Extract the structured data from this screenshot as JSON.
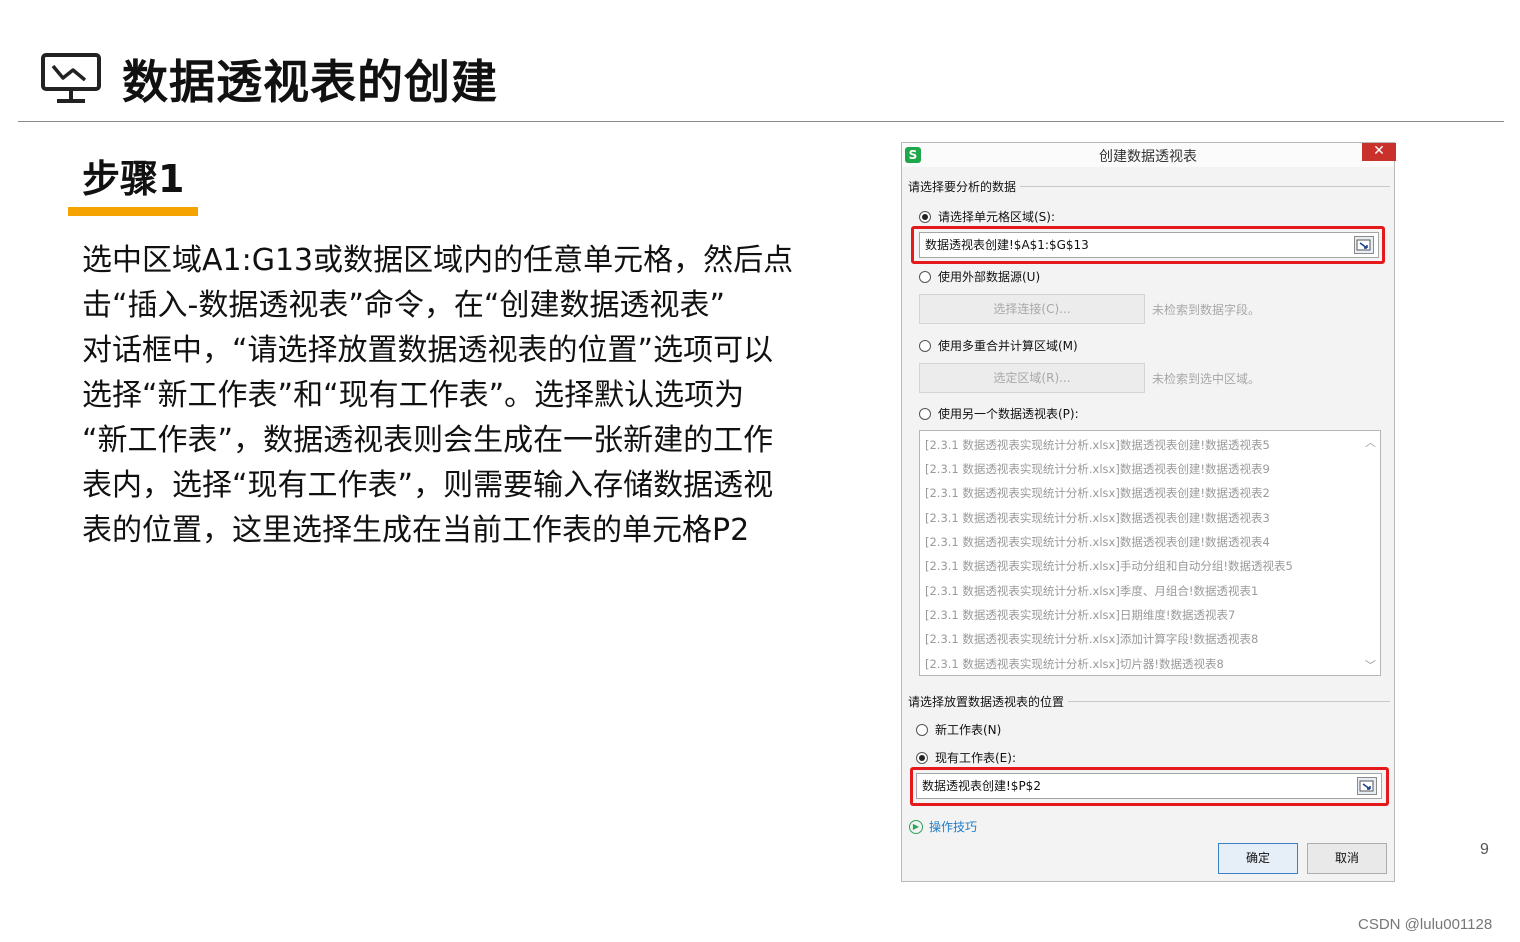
{
  "slide": {
    "title": "数据透视表的创建",
    "step_title": "步骤1",
    "body": "选中区域A1:G13或数据区域内的任意单元格，然后点\n击“插入-数据透视表”命令，在“创建数据透视表”\n对话框中，“请选择放置数据透视表的位置”选项可以\n选择“新工作表”和“现有工作表”。选择默认选项为\n“新工作表”，数据透视表则会生成在一张新建的工作\n表内，选择“现有工作表”，则需要输入存储数据透视\n表的位置，这里选择生成在当前工作表的单元格P2",
    "page_number": "9",
    "watermark": "CSDN @lulu001128",
    "accent_color": "#f5a300"
  },
  "dialog": {
    "app_icon": "S",
    "title": "创建数据透视表",
    "close_label": "✕",
    "section1_label": "请选择要分析的数据",
    "opt_cell_range": {
      "label": "请选择单元格区域(S):",
      "selected": true
    },
    "cell_range_value": "数据透视表创建!$A$1:$G$13",
    "opt_external": {
      "label": "使用外部数据源(U)",
      "selected": false
    },
    "choose_connection_label": "选择连接(C)...",
    "no_fields_note": "未检索到数据字段。",
    "opt_consolidate": {
      "label": "使用多重合并计算区域(M)",
      "selected": false
    },
    "select_area_label": "选定区域(R)...",
    "no_area_note": "未检索到选中区域。",
    "opt_another_pivot": {
      "label": "使用另一个数据透视表(P):",
      "selected": false
    },
    "pivot_list": [
      "[2.3.1 数据透视表实现统计分析.xlsx]数据透视表创建!数据透视表5",
      "[2.3.1 数据透视表实现统计分析.xlsx]数据透视表创建!数据透视表9",
      "[2.3.1 数据透视表实现统计分析.xlsx]数据透视表创建!数据透视表2",
      "[2.3.1 数据透视表实现统计分析.xlsx]数据透视表创建!数据透视表3",
      "[2.3.1 数据透视表实现统计分析.xlsx]数据透视表创建!数据透视表4",
      "[2.3.1 数据透视表实现统计分析.xlsx]手动分组和自动分组!数据透视表5",
      "[2.3.1 数据透视表实现统计分析.xlsx]季度、月组合!数据透视表1",
      "[2.3.1 数据透视表实现统计分析.xlsx]日期维度!数据透视表7",
      "[2.3.1 数据透视表实现统计分析.xlsx]添加计算字段!数据透视表8",
      "[2.3.1 数据透视表实现统计分析.xlsx]切片器!数据透视表8"
    ],
    "section2_label": "请选择放置数据透视表的位置",
    "opt_new_sheet": {
      "label": "新工作表(N)",
      "selected": false
    },
    "opt_existing_sheet": {
      "label": "现有工作表(E):",
      "selected": true
    },
    "location_value": "数据透视表创建!$P$2",
    "tips_label": "操作技巧",
    "ok_label": "确定",
    "cancel_label": "取消",
    "highlight_color": "#e3191b"
  }
}
